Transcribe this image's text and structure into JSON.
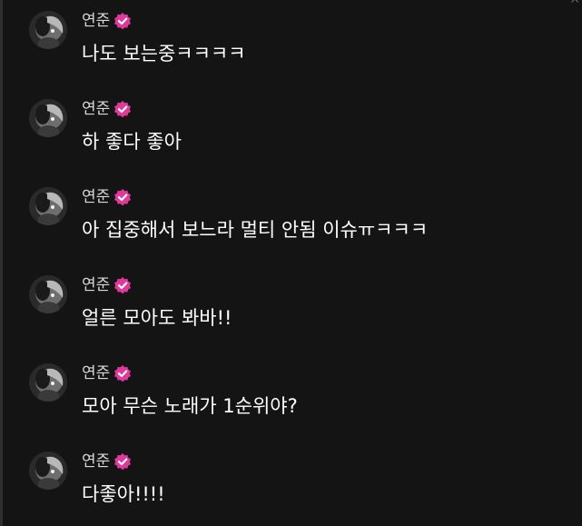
{
  "colors": {
    "background": "#141414",
    "name_text": "#d8d8d8",
    "message_text": "#ffffff",
    "verified_badge": "#e0399d"
  },
  "icons": {
    "avatar": "profile-avatar",
    "verified": "verified-badge-icon",
    "scroll": "scroll-up-caret"
  },
  "scroll_caret": "^",
  "messages": [
    {
      "name": "연준",
      "text": "나도 보는중ㅋㅋㅋㅋ"
    },
    {
      "name": "연준",
      "text": "하 좋다 좋아"
    },
    {
      "name": "연준",
      "text": "아 집중해서 보느라 멀티 안됨 이슈ㅠㅋㅋㅋ"
    },
    {
      "name": "연준",
      "text": "얼른 모아도 봐바!!"
    },
    {
      "name": "연준",
      "text": "모아 무슨 노래가 1순위야?"
    },
    {
      "name": "연준",
      "text": "다좋아!!!!"
    }
  ]
}
